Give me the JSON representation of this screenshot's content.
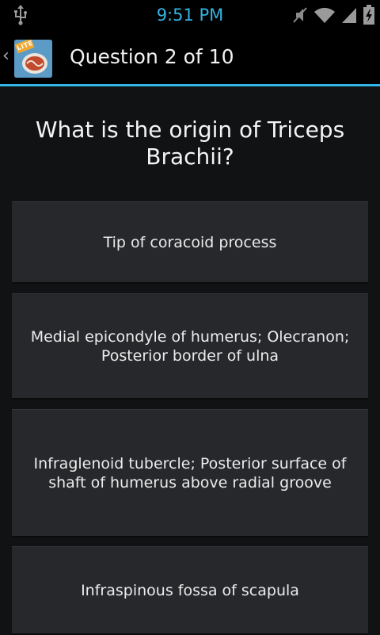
{
  "status_bar": {
    "time": "9:51 PM",
    "icons": [
      "usb-icon",
      "mute-icon",
      "wifi-icon",
      "signal-icon",
      "battery-charging-icon"
    ],
    "accent_color": "#33b5e5"
  },
  "action_bar": {
    "title": "Question 2 of 10",
    "app_icon_badge": "LITE",
    "divider_color": "#33b5e5"
  },
  "quiz": {
    "question": "What is the origin of Triceps Brachii?",
    "answers": [
      {
        "label": "Tip of coracoid process"
      },
      {
        "label": "Medial epicondyle of humerus; Olecranon; Posterior border of ulna"
      },
      {
        "label": "Infraglenoid tubercle; Posterior surface of shaft of humerus above radial groove"
      },
      {
        "label": "Infraspinous fossa of scapula"
      }
    ]
  }
}
